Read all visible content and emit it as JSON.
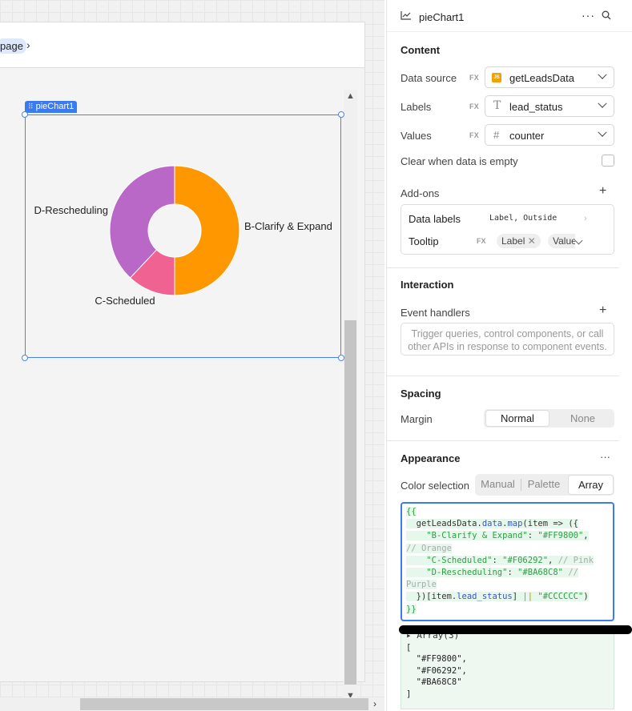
{
  "canvas": {
    "breadcrumb": "page",
    "component_tag": "pieChart1"
  },
  "chart_data": {
    "type": "pie",
    "donut": true,
    "slices": [
      {
        "label": "B-Clarify & Expand",
        "value": 50,
        "color": "#FF9800"
      },
      {
        "label": "C-Scheduled",
        "value": 12,
        "color": "#F06292"
      },
      {
        "label": "D-Rescheduling",
        "value": 38,
        "color": "#BA68C8"
      }
    ],
    "legend": "none",
    "labels_position": "outside"
  },
  "panel": {
    "title": "pieChart1",
    "more": "···",
    "content": {
      "heading": "Content",
      "data_source_label": "Data source",
      "data_source_value": "getLeadsData",
      "labels_label": "Labels",
      "labels_value": "lead_status",
      "values_label": "Values",
      "values_value": "counter",
      "clear_label": "Clear when data is empty",
      "fx": "FX",
      "js_badge": "JS"
    },
    "addons": {
      "heading": "Add-ons",
      "data_labels_label": "Data labels",
      "data_labels_value": "Label, Outside",
      "tooltip_label": "Tooltip",
      "tooltip_chip1": "Label",
      "tooltip_chip2": "Value"
    },
    "interaction": {
      "heading": "Interaction",
      "event_handlers": "Event handlers",
      "placeholder": "Trigger queries, control components, or call other APIs in response to component events."
    },
    "spacing": {
      "heading": "Spacing",
      "margin_label": "Margin",
      "opt_normal": "Normal",
      "opt_none": "None"
    },
    "appearance": {
      "heading": "Appearance",
      "color_selection_label": "Color selection",
      "opt_manual": "Manual",
      "opt_palette": "Palette",
      "opt_array": "Array",
      "code_lines": [
        "{{",
        "  getLeadsData.data.map(item => ({",
        "    \"B-Clarify & Expand\": \"#FF9800\",",
        "// Orange",
        "    \"C-Scheduled\": \"#F06292\", // Pink",
        "    \"D-Rescheduling\": \"#BA68C8\" //",
        "Purple",
        "  })[item.lead_status] || \"#CCCCCC\")",
        "}}"
      ],
      "result_head": "Array(3)",
      "result_lines": [
        "[",
        "  \"#FF9800\",",
        "  \"#F06292\",",
        "  \"#BA68C8\"",
        "]"
      ]
    }
  }
}
